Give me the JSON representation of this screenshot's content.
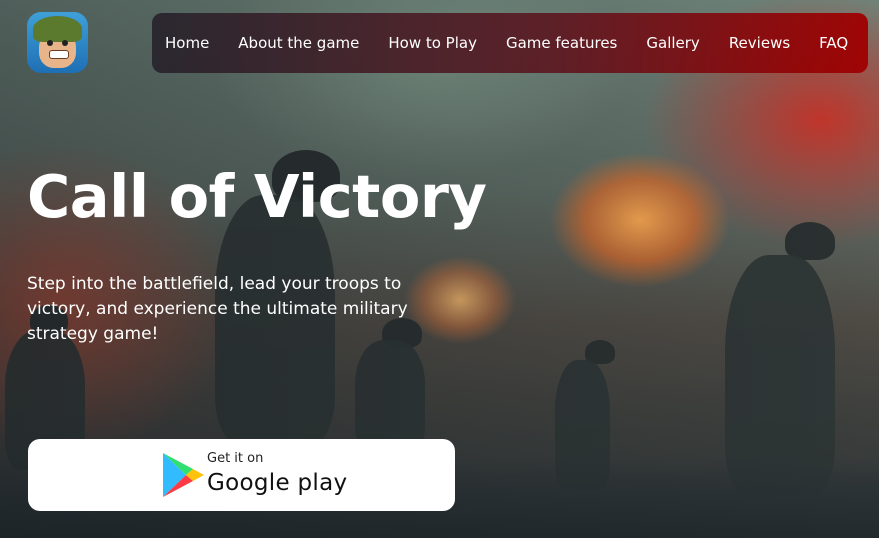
{
  "logo": {
    "icon": "game-mascot-soldier-icon"
  },
  "nav": {
    "items": [
      {
        "label": "Home"
      },
      {
        "label": "About the game"
      },
      {
        "label": "How to Play"
      },
      {
        "label": "Game features"
      },
      {
        "label": "Gallery"
      },
      {
        "label": "Reviews"
      },
      {
        "label": "FAQ"
      }
    ]
  },
  "hero": {
    "title": "Call of Victory",
    "subtitle": "Step into the battlefield, lead your troops to victory, and experience the ultimate military strategy game!"
  },
  "store_button": {
    "small_label": "Get it on",
    "big_label": "Google play",
    "icon": "google-play-icon"
  },
  "colors": {
    "nav_start": "#231e28",
    "nav_end": "#a00000",
    "text": "#ffffff",
    "button_bg": "#ffffff"
  }
}
